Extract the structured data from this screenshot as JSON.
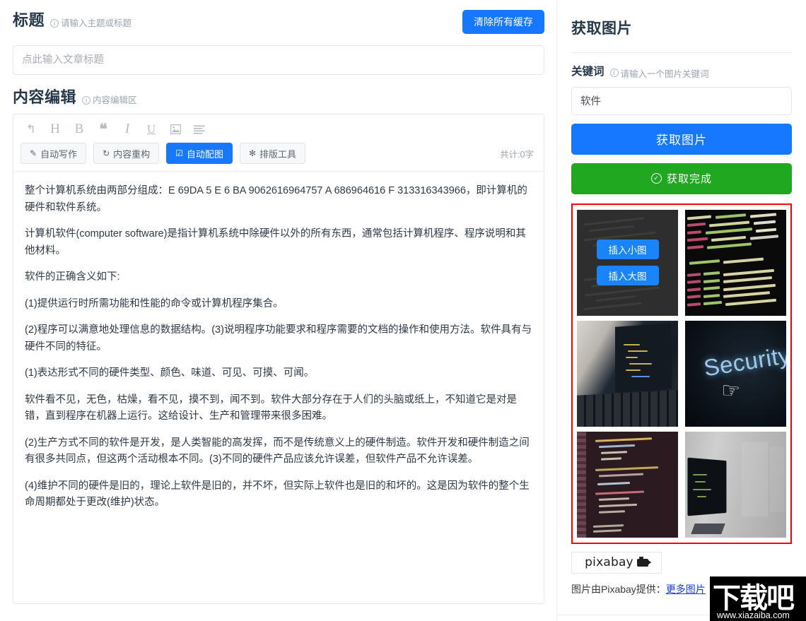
{
  "left": {
    "title_section": {
      "heading": "标题",
      "hint": "请输入主题或标题",
      "clear_cache_button": "清除所有缓存",
      "input_value": "",
      "input_placeholder": "点此输入文章标题"
    },
    "content_section": {
      "heading": "内容编辑",
      "hint": "内容编辑区"
    },
    "toolbar": {
      "icons": [
        {
          "name": "undo-icon",
          "glyph": "↰"
        },
        {
          "name": "heading-icon",
          "glyph": "H"
        },
        {
          "name": "bold-icon",
          "glyph": "B"
        },
        {
          "name": "quote-icon",
          "glyph": "❝"
        },
        {
          "name": "italic-icon",
          "glyph": "I"
        },
        {
          "name": "underline-icon",
          "glyph": "U"
        },
        {
          "name": "image-icon",
          "glyph": "🖼"
        },
        {
          "name": "align-left-icon",
          "glyph": "☰"
        }
      ],
      "buttons": [
        {
          "name": "auto-write-button",
          "icon": "✎",
          "label": "自动写作",
          "active": false
        },
        {
          "name": "content-rewrite-button",
          "icon": "↻",
          "label": "内容重构",
          "active": false
        },
        {
          "name": "auto-image-button",
          "icon": "☑",
          "label": "自动配图",
          "active": true
        },
        {
          "name": "layout-tool-button",
          "icon": "✻",
          "label": "排版工具",
          "active": false
        }
      ],
      "word_count": "共计:0字"
    },
    "document_paragraphs": [
      "整个计算机系统由两部分组成：E 69DA 5 E 6 BA 9062616964757 A 686964616 F 313316343966，即计算机的硬件和软件系统。",
      "计算机软件(computer software)是指计算机系统中除硬件以外的所有东西，通常包括计算机程序、程序说明和其他材料。",
      "软件的正确含义如下:",
      "(1)提供运行时所需功能和性能的命令或计算机程序集合。",
      "(2)程序可以满意地处理信息的数据结构。(3)说明程序功能要求和程序需要的文档的操作和使用方法。软件具有与硬件不同的特征。",
      "(1)表达形式不同的硬件类型、颜色、味道、可见、可摸、可闻。",
      "软件看不见，无色，枯燥，看不见，摸不到，闻不到。软件大部分存在于人们的头脑或纸上，不知道它是对是错，直到程序在机器上运行。这给设计、生产和管理带来很多困难。",
      "(2)生产方式不同的软件是开发，是人类智能的高发挥，而不是传统意义上的硬件制造。软件开发和硬件制造之间有很多共同点，但这两个活动根本不同。(3)不同的硬件产品应该允许误差，但软件产品不允许误差。",
      "(4)维护不同的硬件是旧的，理论上软件是旧的，并不坏，但实际上软件也是旧的和坏的。这是因为软件的整个生命周期都处于更改(维护)状态。"
    ]
  },
  "right": {
    "panel_title": "获取图片",
    "keyword_label": "关键词",
    "keyword_hint": "请输入一个图片关键词",
    "keyword_value": "软件",
    "keyword_placeholder": "请输入一个图片关键词",
    "fetch_button": "获取图片",
    "done_button": "获取完成",
    "thumbnails": [
      {
        "name": "thumbnail-code-dark",
        "alt": "dark code editor",
        "hovered": true
      },
      {
        "name": "thumbnail-terminal",
        "alt": "colorful terminal code"
      },
      {
        "name": "thumbnail-laptop-code",
        "alt": "laptop with code on screen"
      },
      {
        "name": "thumbnail-security",
        "alt": "Security text with hand cursor"
      },
      {
        "name": "thumbnail-code-red",
        "alt": "reddish code screen"
      },
      {
        "name": "thumbnail-monitor",
        "alt": "monitor on grey wall"
      }
    ],
    "insert_small_label": "插入小图",
    "insert_large_label": "插入大图",
    "pixabay_logo_text": "pixabay",
    "credit_prefix": "图片由Pixabay提供：",
    "credit_link": "更多图片"
  },
  "watermark": {
    "brand": "下载吧",
    "url": "www.xiazaiba.com"
  },
  "colors": {
    "primary_blue": "#1677ff",
    "success_green": "#20a820",
    "highlight_red": "#fe0000",
    "heading": "#273849",
    "muted": "#9aa4ae",
    "link": "#1a3fd4"
  }
}
